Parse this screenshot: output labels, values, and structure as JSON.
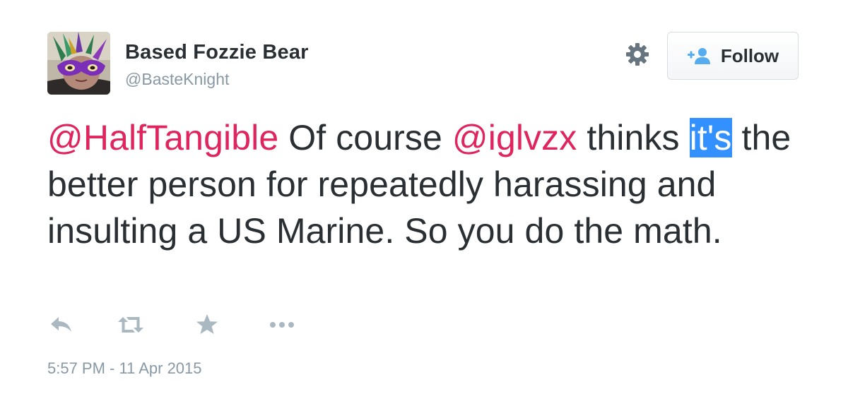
{
  "user": {
    "display_name": "Based Fozzie Bear",
    "handle": "@BasteKnight",
    "avatar_icon": "masked-user-avatar"
  },
  "header": {
    "settings_icon": "gear-icon",
    "follow_label": "Follow",
    "follow_icon": "add-user-icon"
  },
  "tweet": {
    "mention_1": "@HalfTangible",
    "text_1": " Of course ",
    "mention_2": "@iglvzx",
    "text_2": " thinks ",
    "highlighted": "it's",
    "text_3": " the better person for repeatedly harassing and insulting a US Marine. So you do the math."
  },
  "actions": {
    "reply_icon": "reply-icon",
    "retweet_icon": "retweet-icon",
    "favorite_icon": "star-icon",
    "more_icon": "more-dots-icon"
  },
  "timestamp": "5:57 PM - 11 Apr 2015",
  "colors": {
    "mention": "#e0245e",
    "selection": "#3390ff",
    "muted_text": "#8899a6",
    "body_text": "#292f33",
    "icon": "#aab8c2",
    "follow_icon_blue": "#55acee"
  }
}
